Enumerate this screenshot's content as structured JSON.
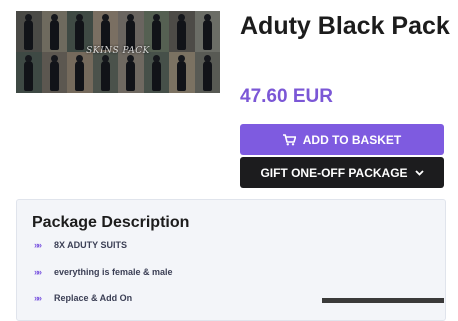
{
  "product": {
    "title": "Aduty Black Pack",
    "price": "47.60 EUR",
    "image_logo": "SKINS PACK",
    "image_alt": "Aduty Black Pack preview"
  },
  "actions": {
    "add_to_basket": "ADD TO BASKET",
    "gift_package": "GIFT ONE-OFF PACKAGE"
  },
  "description": {
    "heading": "Package Description",
    "features": [
      "8X ADUTY SUITS",
      "everything is female & male",
      "Replace & Add On"
    ]
  },
  "icons": {
    "basket": "shopping-cart-icon",
    "gift_chevron": "chevron-down-icon",
    "feature_bullet": "double-chevron-right-icon"
  },
  "colors": {
    "accent": "#7e5be0",
    "price": "#7b57d6",
    "dark_button": "#1c1c1e"
  }
}
